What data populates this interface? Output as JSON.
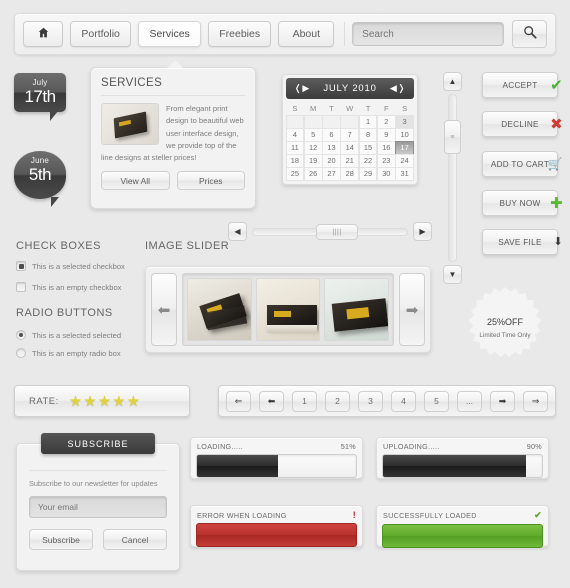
{
  "nav": {
    "home_icon": "home-icon",
    "items": [
      {
        "label": "Portfolio",
        "active": false
      },
      {
        "label": "Services",
        "active": true
      },
      {
        "label": "Freebies",
        "active": false
      },
      {
        "label": "About",
        "active": false
      }
    ],
    "search_placeholder": "Search",
    "search_value": "",
    "search_icon": "magnifier-icon"
  },
  "badges": [
    {
      "month": "July",
      "day": "17th"
    },
    {
      "month": "June",
      "day": "5th"
    }
  ],
  "services": {
    "title": "SERVICES",
    "body": "From elegant print design to beautiful web user interface design, we provide top of the line designs at steller prices!",
    "buttons": [
      "View All",
      "Prices"
    ]
  },
  "calendar": {
    "title": "JULY 2010",
    "prev_icon": "arrow-left-icon",
    "next_icon": "arrow-right-icon",
    "dow": [
      "S",
      "M",
      "T",
      "W",
      "T",
      "F",
      "S"
    ],
    "lead_blanks": 4,
    "days": 31,
    "soft_day": 3,
    "selected_day": 17
  },
  "actions": [
    {
      "label": "ACCEPT",
      "glyph": "✔",
      "color": "#4caf33",
      "icon": "check-icon"
    },
    {
      "label": "DECLINE",
      "glyph": "✖",
      "color": "#cf3b33",
      "icon": "cross-icon"
    },
    {
      "label": "ADD TO CART",
      "glyph": "🛒",
      "color": "#3a3a3a",
      "icon": "cart-icon"
    },
    {
      "label": "BUY NOW",
      "glyph": "✚",
      "color": "#5ab833",
      "icon": "plus-icon"
    },
    {
      "label": "SAVE FILE",
      "glyph": "⬇",
      "color": "#3a3a3a",
      "icon": "download-icon"
    }
  ],
  "checkboxes": {
    "title": "CHECK BOXES",
    "items": [
      {
        "label": "This is a selected checkbox",
        "checked": true
      },
      {
        "label": "This is an empty checkbox",
        "checked": false
      }
    ]
  },
  "radios": {
    "title": "RADIO BUTTONS",
    "items": [
      {
        "label": "This is a selected selected",
        "checked": true
      },
      {
        "label": "This is an empty radio box",
        "checked": false
      }
    ]
  },
  "slider": {
    "title": "IMAGE SLIDER",
    "prev_icon": "arrow-left-icon",
    "next_icon": "arrow-right-icon",
    "slides": [
      "business-card-fan",
      "business-card-stack",
      "business-card-angled"
    ]
  },
  "scrollbars": {
    "vertical": {
      "up_icon": "arrow-up-icon",
      "down_icon": "arrow-down-icon",
      "grip": "≡"
    },
    "horizontal": {
      "left_icon": "arrow-left-icon",
      "right_icon": "arrow-right-icon",
      "grip": "||||"
    }
  },
  "discount": {
    "percent": "25%",
    "off": "OFF",
    "sub": "Limited Time Only"
  },
  "rate": {
    "label": "RATE:",
    "stars": 5,
    "filled": 5,
    "star_color": "#dfd23c"
  },
  "pagination": {
    "pages": [
      "1",
      "2",
      "3",
      "4",
      "5",
      "..."
    ],
    "first_icon": "double-arrow-left-icon",
    "prev_icon": "arrow-left-icon",
    "next_icon": "arrow-right-icon",
    "last_icon": "double-arrow-right-icon"
  },
  "subscribe": {
    "tab": "SUBSCRIBE",
    "desc": "Subscribe to our newsletter for updates",
    "email_placeholder": "Your email",
    "email_value": "",
    "submit": "Subscribe",
    "cancel": "Cancel"
  },
  "progress": [
    {
      "label": "LOADING.....",
      "value": "51%",
      "percent": 51
    },
    {
      "label": "UPLOADING.....",
      "value": "90%",
      "percent": 90
    }
  ],
  "alerts": [
    {
      "label": "ERROR WHEN LOADING",
      "mark": "!",
      "type": "err",
      "color": "#b7302c"
    },
    {
      "label": "SUCCESSFULLY LOADED",
      "mark": "✔",
      "type": "ok",
      "color": "#5faa2c"
    }
  ]
}
